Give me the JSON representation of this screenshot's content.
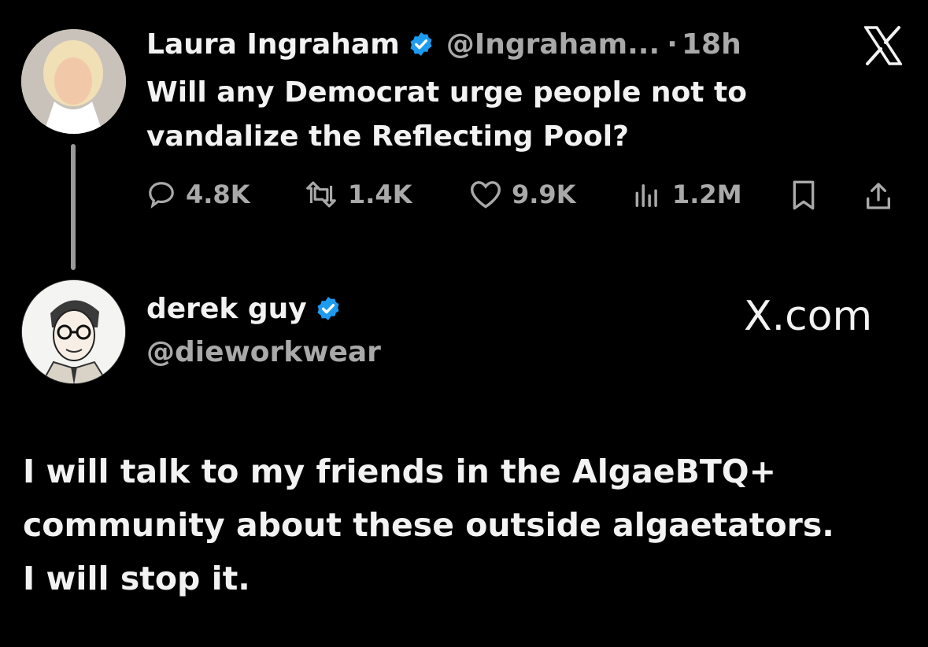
{
  "original_tweet": {
    "author_name": "Laura Ingraham",
    "handle": "@Ingraham...",
    "separator": "·",
    "time": "18h",
    "text_line1": "Will any Democrat urge people not to",
    "text_line2": "vandalize the Reflecting Pool?",
    "metrics": {
      "replies": "4.8K",
      "reposts": "1.4K",
      "likes": "9.9K",
      "views": "1.2M"
    }
  },
  "reply_tweet": {
    "author_name": "derek guy",
    "handle": "@dieworkwear",
    "source": "X.com",
    "text_line1": "I will talk to my friends in the AlgaeBTQ+",
    "text_line2": "community about these outside algaetators.",
    "text_line3": "I will stop it."
  },
  "colors": {
    "background": "#000000",
    "text": "#f2f2f2",
    "muted": "#a9a9a9",
    "verified": "#1d9bf0"
  },
  "icons": [
    "x-logo-icon",
    "verified-icon",
    "reply-icon",
    "repost-icon",
    "like-icon",
    "views-icon",
    "bookmark-icon",
    "share-icon"
  ]
}
